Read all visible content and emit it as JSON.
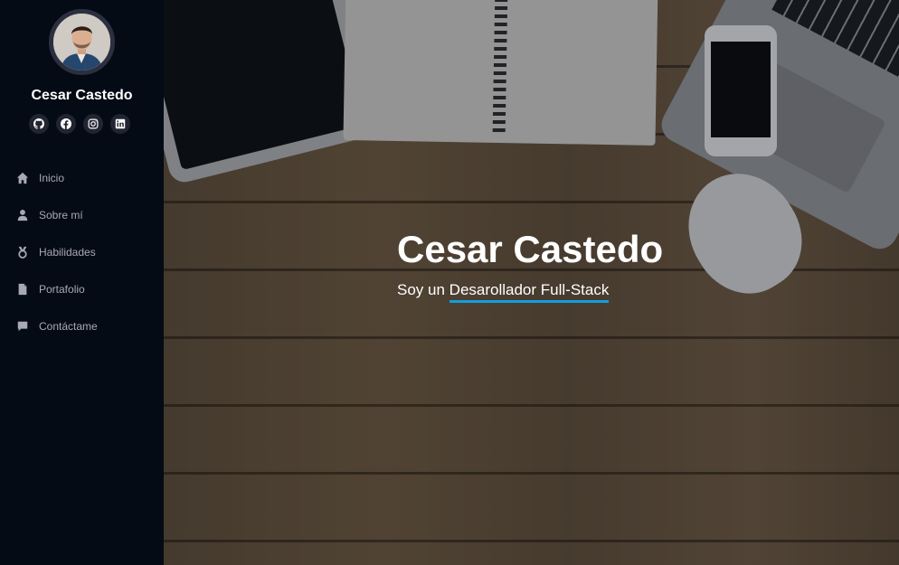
{
  "profile": {
    "name": "Cesar Castedo"
  },
  "social": [
    {
      "name": "github-icon"
    },
    {
      "name": "facebook-icon"
    },
    {
      "name": "instagram-icon"
    },
    {
      "name": "linkedin-icon"
    }
  ],
  "nav": {
    "items": [
      {
        "label": "Inicio",
        "icon": "home-icon"
      },
      {
        "label": "Sobre mí",
        "icon": "user-icon"
      },
      {
        "label": "Habilidades",
        "icon": "medal-icon"
      },
      {
        "label": "Portafolio",
        "icon": "file-icon"
      },
      {
        "label": "Contáctame",
        "icon": "chat-icon"
      }
    ]
  },
  "hero": {
    "title": "Cesar Castedo",
    "subtitle_prefix": "Soy un",
    "typed_text": "Desarollador Full-Stack"
  },
  "colors": {
    "sidebar_bg": "#040b14",
    "accent": "#149ddd",
    "nav_text": "#a8a9b4"
  }
}
